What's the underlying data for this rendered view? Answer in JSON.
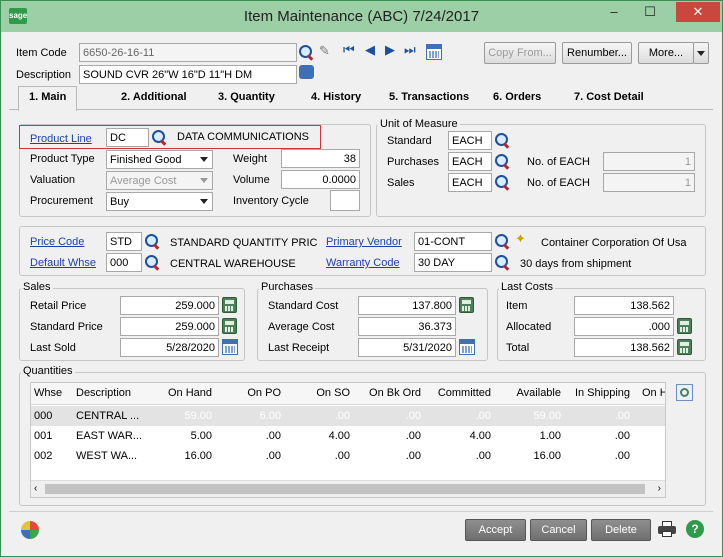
{
  "window": {
    "title": "Item Maintenance (ABC) 7/24/2017",
    "logo": "sage",
    "minimize": "–",
    "maximize": "☐",
    "close": "✕"
  },
  "header": {
    "item_code_label": "Item Code",
    "item_code_value": "6650-26-16-11",
    "description_label": "Description",
    "description_value": "SOUND CVR 26\"W 16\"D 11\"H DM",
    "copy_from_label": "Copy From...",
    "renumber_label": "Renumber...",
    "more_label": "More..."
  },
  "tabs": [
    {
      "label": "1. Main"
    },
    {
      "label": "2. Additional"
    },
    {
      "label": "3. Quantity"
    },
    {
      "label": "4. History"
    },
    {
      "label": "5. Transactions"
    },
    {
      "label": "6. Orders"
    },
    {
      "label": "7. Cost Detail"
    }
  ],
  "main": {
    "product_line_label": "Product Line",
    "product_line_value": "DC",
    "product_line_desc": "DATA COMMUNICATIONS",
    "product_type_label": "Product Type",
    "product_type_value": "Finished Good",
    "valuation_label": "Valuation",
    "valuation_value": "Average Cost",
    "procurement_label": "Procurement",
    "procurement_value": "Buy",
    "weight_label": "Weight",
    "weight_value": "38",
    "volume_label": "Volume",
    "volume_value": "0.0000",
    "inventory_cycle_label": "Inventory Cycle",
    "inventory_cycle_value": ""
  },
  "uom": {
    "title": "Unit of Measure",
    "standard_label": "Standard",
    "standard_value": "EACH",
    "purchases_label": "Purchases",
    "purchases_value": "EACH",
    "sales_label": "Sales",
    "sales_value": "EACH",
    "no_of_each_1_label": "No. of  EACH",
    "no_of_each_1_value": "1",
    "no_of_each_2_label": "No. of  EACH",
    "no_of_each_2_value": "1"
  },
  "codes": {
    "price_code_label": "Price Code",
    "price_code_value": "STD",
    "price_code_desc": "STANDARD QUANTITY PRICING",
    "default_whse_label": "Default Whse",
    "default_whse_value": "000",
    "default_whse_desc": "CENTRAL WAREHOUSE",
    "primary_vendor_label": "Primary Vendor",
    "primary_vendor_value": "01-CONT",
    "primary_vendor_desc": "Container Corporation Of Usa",
    "warranty_code_label": "Warranty Code",
    "warranty_code_value": "30 DAY",
    "warranty_code_desc": "30 days from shipment"
  },
  "sales": {
    "title": "Sales",
    "retail_price_label": "Retail Price",
    "retail_price_value": "259.000",
    "standard_price_label": "Standard Price",
    "standard_price_value": "259.000",
    "last_sold_label": "Last Sold",
    "last_sold_value": "5/28/2020"
  },
  "purchases": {
    "title": "Purchases",
    "standard_cost_label": "Standard Cost",
    "standard_cost_value": "137.800",
    "average_cost_label": "Average Cost",
    "average_cost_value": "36.373",
    "last_receipt_label": "Last Receipt",
    "last_receipt_value": "5/31/2020"
  },
  "last_costs": {
    "title": "Last Costs",
    "item_label": "Item",
    "item_value": "138.562",
    "allocated_label": "Allocated",
    "allocated_value": ".000",
    "total_label": "Total",
    "total_value": "138.562"
  },
  "quantities": {
    "title": "Quantities",
    "columns": [
      "Whse",
      "Description",
      "On Hand",
      "On PO",
      "On SO",
      "On Bk Ord",
      "Committed",
      "Available",
      "In Shipping",
      "On H"
    ],
    "rows": [
      [
        "000",
        "CENTRAL ...",
        "59.00",
        "6.00",
        ".00",
        ".00",
        ".00",
        "59.00",
        ".00",
        ""
      ],
      [
        "001",
        "EAST WAR...",
        "5.00",
        ".00",
        "4.00",
        ".00",
        "4.00",
        "1.00",
        ".00",
        ""
      ],
      [
        "002",
        "WEST WA...",
        "16.00",
        ".00",
        ".00",
        ".00",
        ".00",
        "16.00",
        ".00",
        ""
      ]
    ]
  },
  "footer": {
    "accept_label": "Accept",
    "cancel_label": "Cancel",
    "delete_label": "Delete"
  },
  "colors": {
    "titlebar": "#9ccfa6",
    "close": "#c9473c",
    "highlight_border": "#d0323a",
    "link": "#1f3fa8"
  }
}
